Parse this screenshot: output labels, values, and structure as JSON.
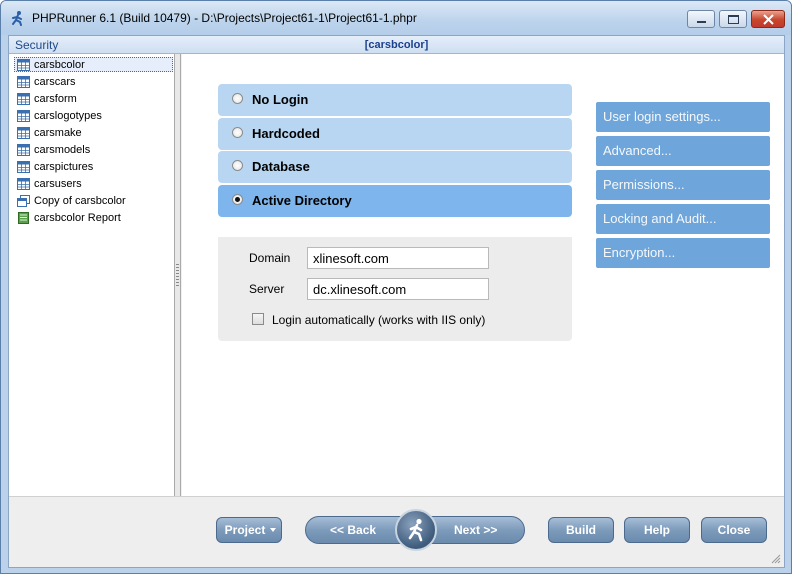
{
  "window": {
    "title": "PHPRunner 6.1 (Build 10479) - D:\\Projects\\Project61-1\\Project61-1.phpr"
  },
  "caption": {
    "section": "Security",
    "current_table": "[carsbcolor]"
  },
  "tree": {
    "items": [
      {
        "label": "carsbcolor",
        "icon": "table-icon",
        "selected": true
      },
      {
        "label": "carscars",
        "icon": "table-icon"
      },
      {
        "label": "carsform",
        "icon": "table-icon"
      },
      {
        "label": "carslogotypes",
        "icon": "table-icon"
      },
      {
        "label": "carsmake",
        "icon": "table-icon"
      },
      {
        "label": "carsmodels",
        "icon": "table-icon"
      },
      {
        "label": "carspictures",
        "icon": "table-icon"
      },
      {
        "label": "carsusers",
        "icon": "table-icon"
      },
      {
        "label": "Copy of carsbcolor",
        "icon": "copy-table-icon"
      },
      {
        "label": "carsbcolor Report",
        "icon": "report-icon"
      }
    ]
  },
  "login_options": [
    {
      "label": "No Login",
      "checked": false
    },
    {
      "label": "Hardcoded",
      "checked": false
    },
    {
      "label": "Database",
      "checked": false
    },
    {
      "label": "Active Directory",
      "checked": true
    }
  ],
  "active_directory": {
    "domain_label": "Domain",
    "domain_value": "xlinesoft.com",
    "server_label": "Server",
    "server_value": "dc.xlinesoft.com",
    "auto_login_label": "Login automatically (works with IIS only)",
    "auto_login_checked": false
  },
  "side_buttons": [
    "User login settings...",
    "Advanced...",
    "Permissions...",
    "Locking and Audit...",
    "Encryption..."
  ],
  "bottom": {
    "project": "Project",
    "back": "<< Back",
    "next": "Next >>",
    "build": "Build",
    "help": "Help",
    "close": "Close"
  },
  "colors": {
    "option_bg": "#b8d6f2",
    "option_active_bg": "#7eb5ec",
    "side_button_bg": "#6ea5da",
    "caption_text": "#1a3f8f"
  }
}
